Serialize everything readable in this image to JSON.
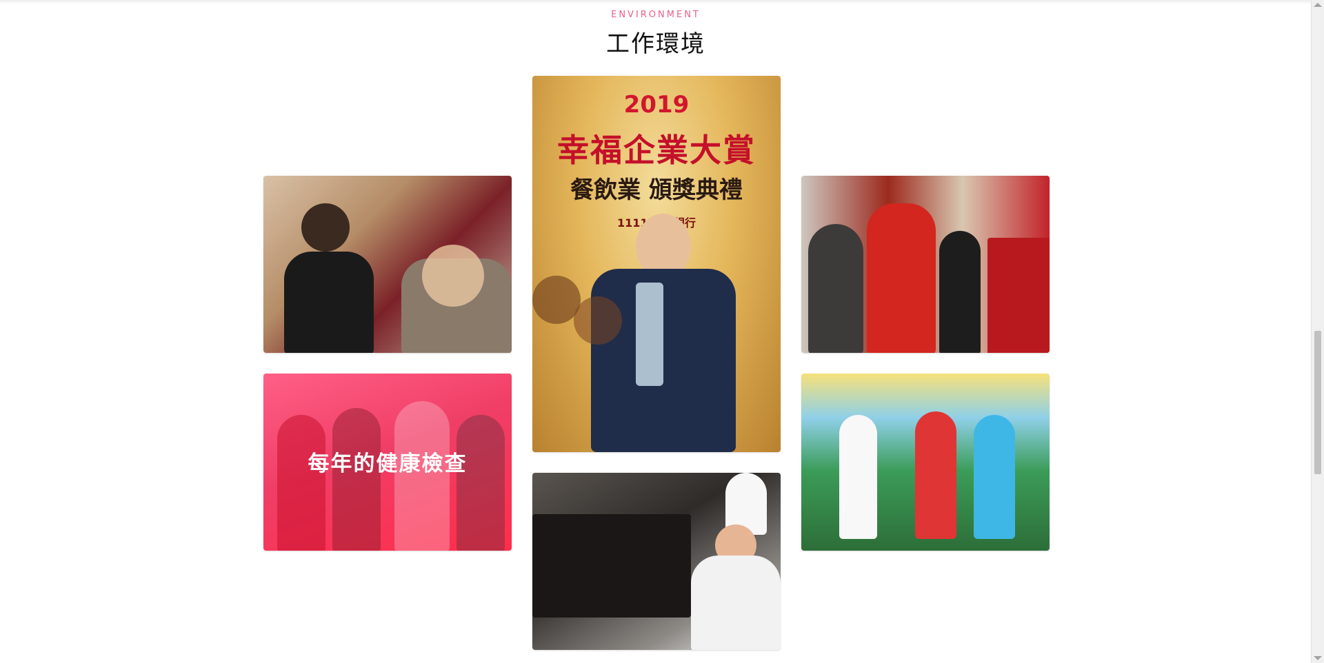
{
  "section": {
    "kicker": "ENVIRONMENT",
    "title": "工作環境"
  },
  "gallery": {
    "center_poster": {
      "year": "2019",
      "headline": "幸福企業大賞",
      "subline": "餐飲業 頒獎典禮",
      "sponsor": "1111 人力銀行"
    },
    "health_tile": {
      "caption": "每年的健康檢查"
    },
    "tiles": [
      {
        "name": "counter-staff-photo"
      },
      {
        "name": "award-ceremony-photo"
      },
      {
        "name": "bakery-chef-photo"
      },
      {
        "name": "god-of-wealth-event-photo"
      },
      {
        "name": "family-day-stage-photo"
      }
    ]
  },
  "colors": {
    "accent": "#ea5e8a",
    "health_overlay": "#f03e66"
  }
}
